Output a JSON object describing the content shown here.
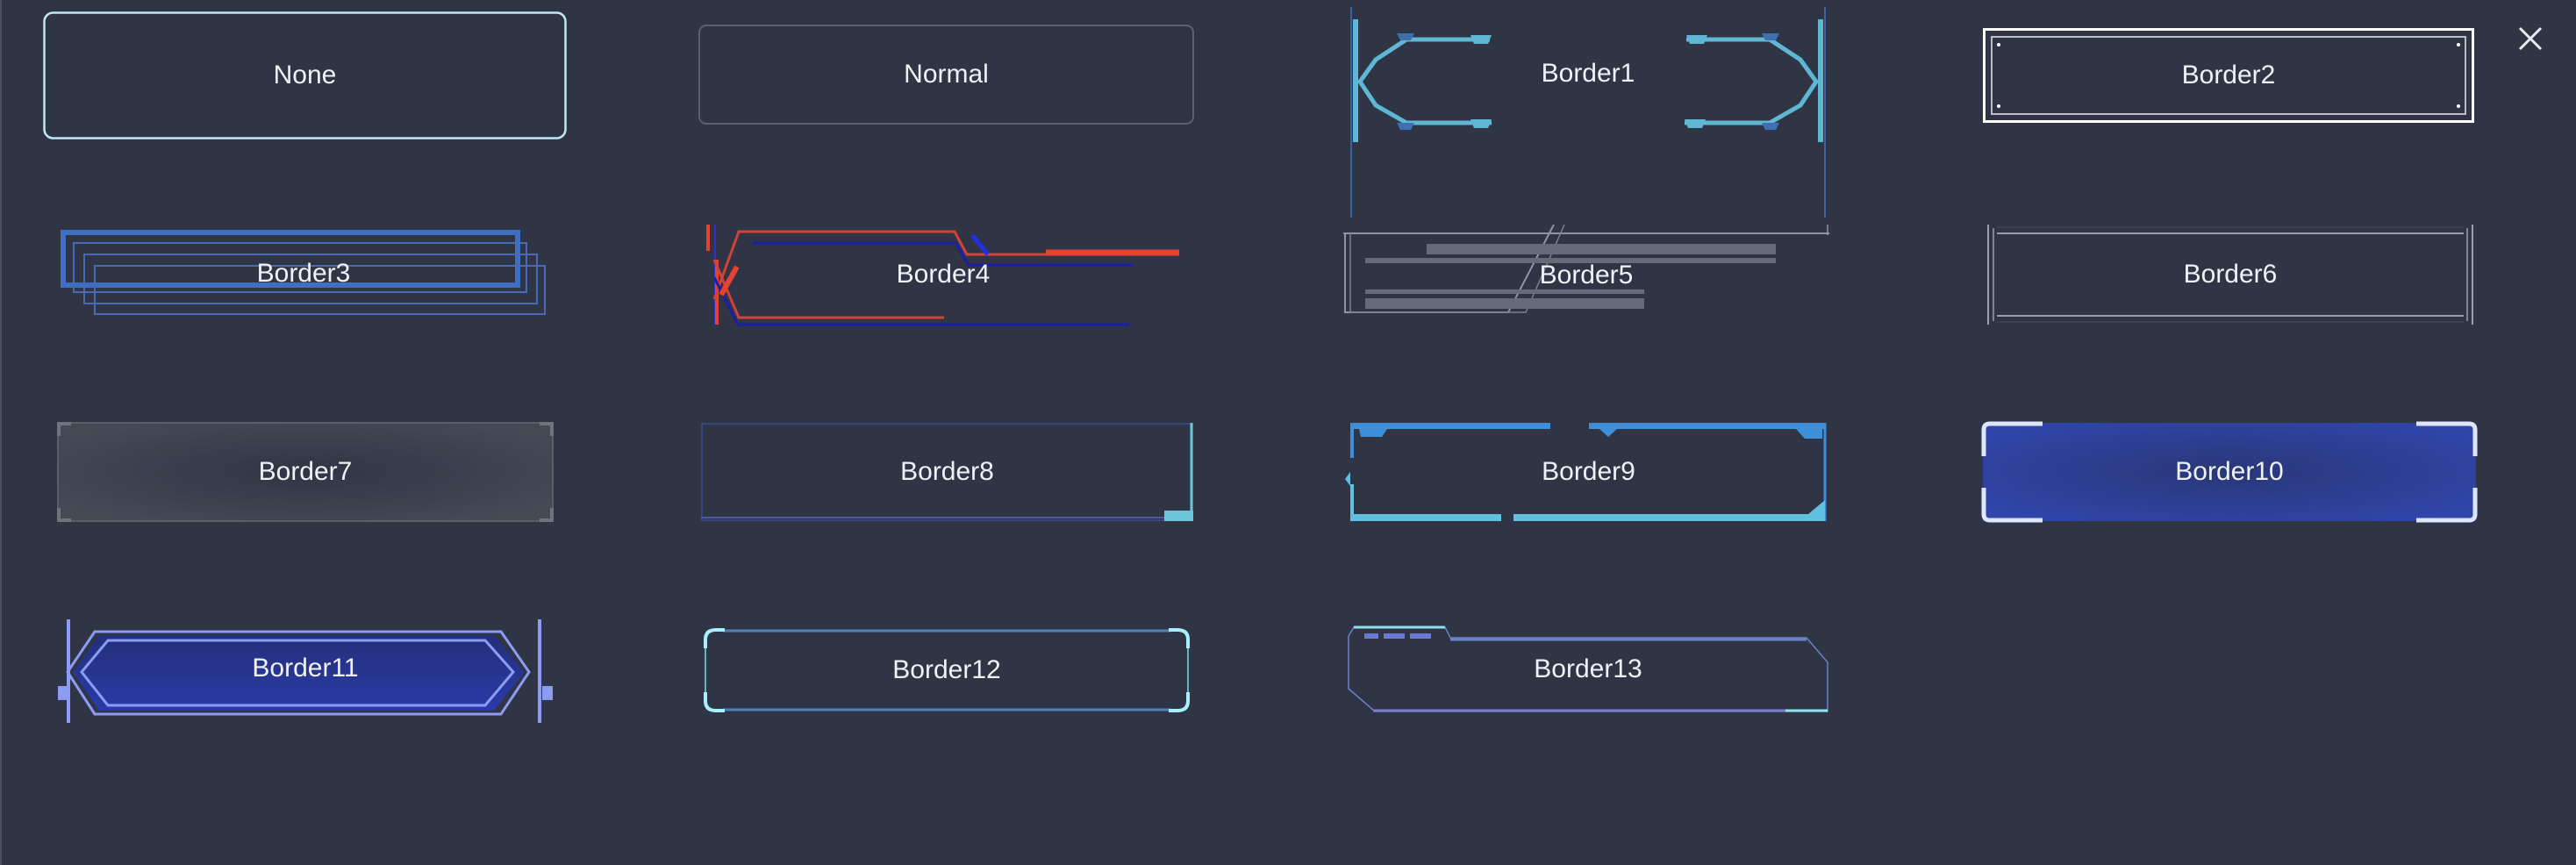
{
  "close_button": {
    "icon": "close-icon",
    "label": "Close"
  },
  "colors": {
    "background": "#2f3545",
    "text": "#eef1f6",
    "cyan": "#5fb7d4",
    "blue": "#3f6fc4",
    "red": "#e8412f",
    "navy": "#1a1fa8"
  },
  "borders": [
    {
      "id": "none",
      "label": "None"
    },
    {
      "id": "normal",
      "label": "Normal"
    },
    {
      "id": "border1",
      "label": "Border1"
    },
    {
      "id": "border2",
      "label": "Border2"
    },
    {
      "id": "border3",
      "label": "Border3"
    },
    {
      "id": "border4",
      "label": "Border4"
    },
    {
      "id": "border5",
      "label": "Border5"
    },
    {
      "id": "border6",
      "label": "Border6"
    },
    {
      "id": "border7",
      "label": "Border7"
    },
    {
      "id": "border8",
      "label": "Border8"
    },
    {
      "id": "border9",
      "label": "Border9"
    },
    {
      "id": "border10",
      "label": "Border10"
    },
    {
      "id": "border11",
      "label": "Border11"
    },
    {
      "id": "border12",
      "label": "Border12"
    },
    {
      "id": "border13",
      "label": "Border13"
    }
  ]
}
